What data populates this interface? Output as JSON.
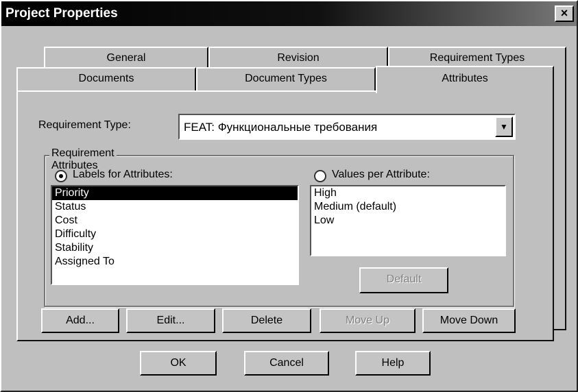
{
  "window": {
    "title": "Project Properties",
    "close_glyph": "×"
  },
  "tabs": {
    "row1": [
      "General",
      "Revision",
      "Requirement Types"
    ],
    "row2": [
      "Documents",
      "Document Types",
      "Attributes"
    ],
    "active": "Attributes"
  },
  "requirement_type": {
    "label": "Requirement Type:",
    "value": "FEAT: Функциональные требования",
    "arrow": "▼"
  },
  "requirement_attributes": {
    "group_label": "Requirement Attributes",
    "labels_radio": "Labels for Attributes:",
    "values_radio": "Values per Attribute:",
    "selected_radio": "labels",
    "labels": [
      "Priority",
      "Status",
      "Cost",
      "Difficulty",
      "Stability",
      "Assigned To"
    ],
    "selected_label": "Priority",
    "values": [
      "High",
      "Medium (default)",
      "Low"
    ],
    "default_button": "Default"
  },
  "action_buttons": {
    "add": "Add...",
    "edit": "Edit...",
    "delete": "Delete",
    "move_up": "Move Up",
    "move_down": "Move Down"
  },
  "dialog_buttons": {
    "ok": "OK",
    "cancel": "Cancel",
    "help": "Help"
  }
}
